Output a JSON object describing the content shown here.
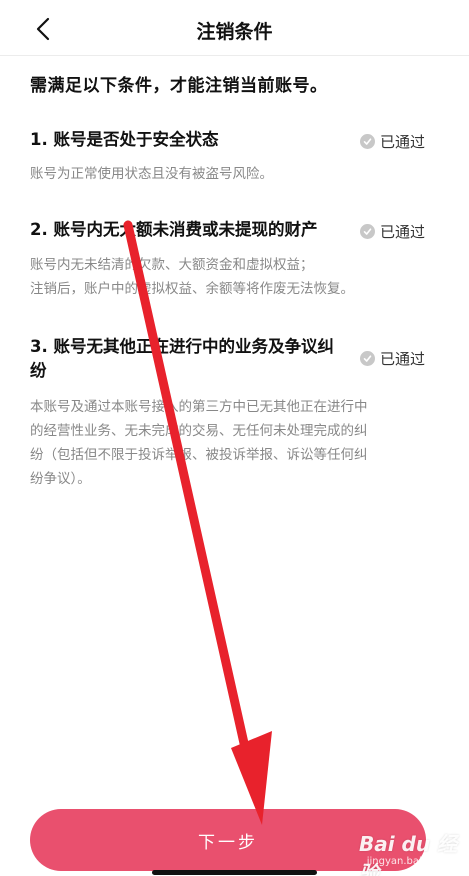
{
  "header": {
    "back_icon": "chevron-left-icon",
    "title": "注销条件"
  },
  "intro": "需满足以下条件，才能注销当前账号。",
  "conditions": [
    {
      "title": "1. 账号是否处于安全状态",
      "status": "已通过",
      "desc": [
        "账号为正常使用状态且没有被盗号风险。"
      ]
    },
    {
      "title": "2. 账号内无大额未消费或未提现的财产",
      "status": "已通过",
      "desc": [
        "账号内无未结清的欠款、大额资金和虚拟权益；",
        "注销后，账户中的虚拟权益、余额等将作废无法恢复。"
      ]
    },
    {
      "title": "3. 账号无其他正在进行中的业务及争议纠纷",
      "status": "已通过",
      "desc": [
        "本账号及通过本账号接入的第三方中已无其他正在进行中",
        "的经营性业务、无未完成的交易、无任何未处理完成的纠",
        "纷（包括但不限于投诉举报、被投诉举报、诉讼等任何纠",
        "纷争议）。"
      ]
    }
  ],
  "next_button": "下一步",
  "watermark": {
    "logo": "Bai du 经验",
    "url": "jingyan.baidu.com"
  },
  "colors": {
    "accent": "#e9506e",
    "arrow": "#e8222c",
    "check": "#c8c8c8"
  }
}
